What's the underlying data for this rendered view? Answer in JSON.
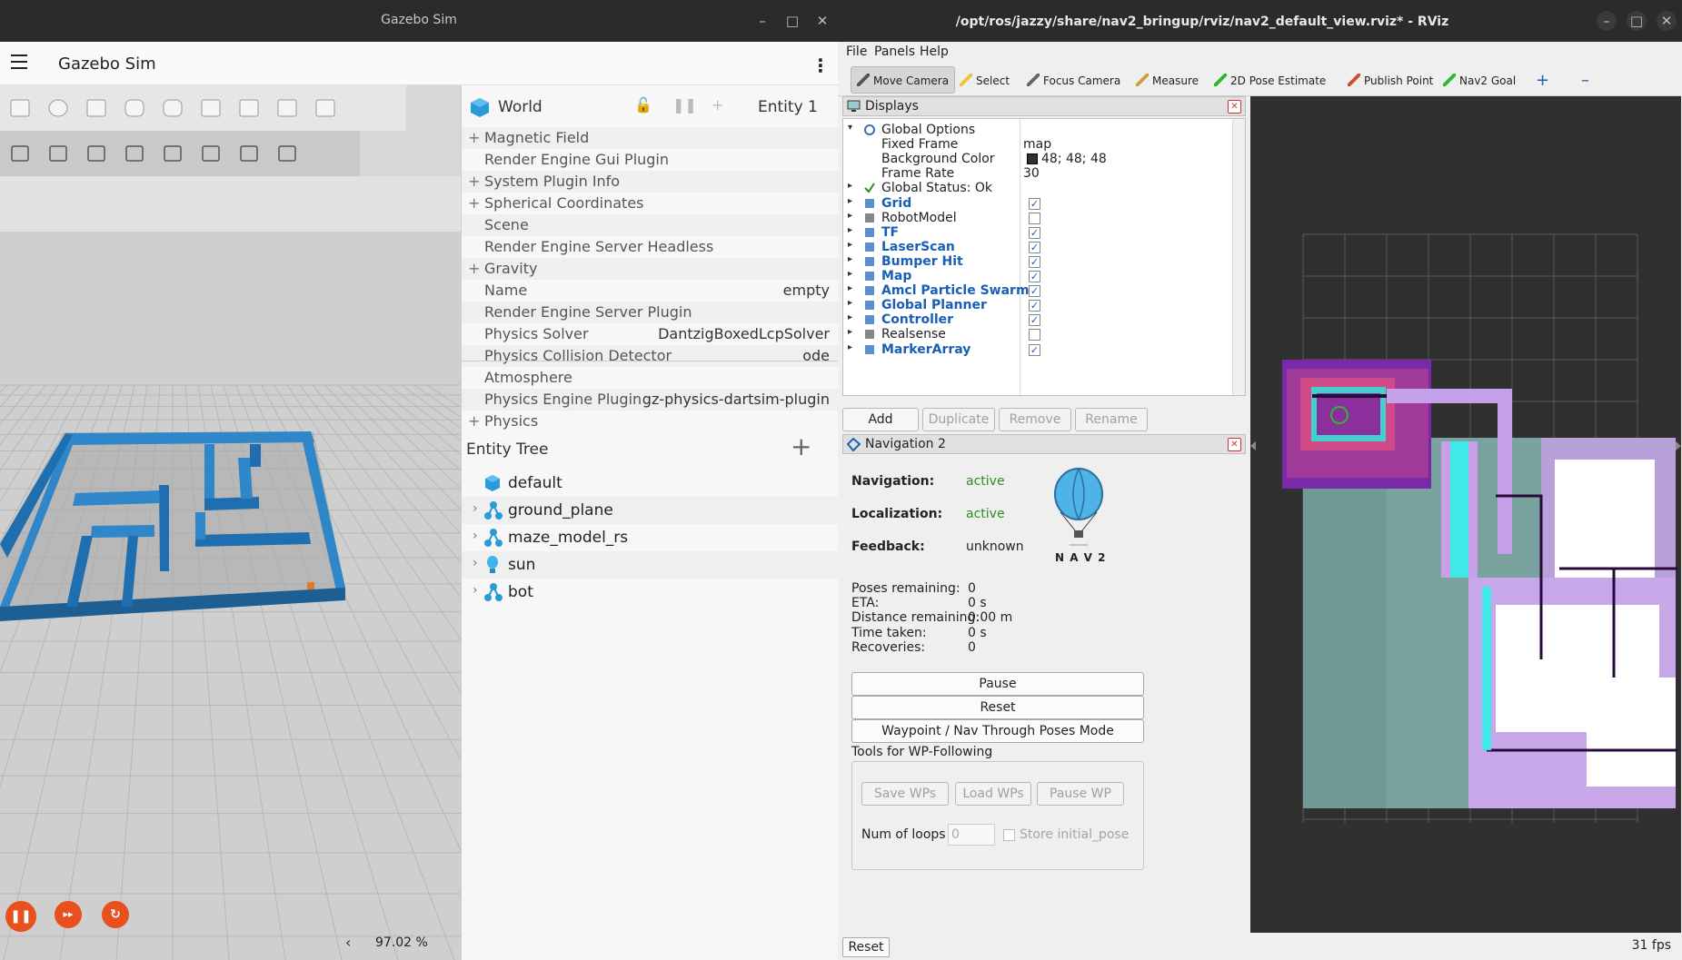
{
  "gazebo": {
    "window_title": "Gazebo Sim",
    "app_title": "Gazebo Sim",
    "zoom": "97.02 %",
    "world": {
      "title": "World",
      "entity_label": "Entity 1",
      "properties": [
        {
          "expand": "+",
          "key": "Magnetic Field",
          "value": ""
        },
        {
          "expand": "",
          "key": "Render Engine Gui Plugin",
          "value": ""
        },
        {
          "expand": "+",
          "key": "System Plugin Info",
          "value": ""
        },
        {
          "expand": "+",
          "key": "Spherical Coordinates",
          "value": ""
        },
        {
          "expand": "",
          "key": "Scene",
          "value": ""
        },
        {
          "expand": "",
          "key": "Render Engine Server Headless",
          "value": ""
        },
        {
          "expand": "+",
          "key": "Gravity",
          "value": ""
        },
        {
          "expand": "",
          "key": "Name",
          "value": "empty"
        },
        {
          "expand": "",
          "key": "Render Engine Server Plugin",
          "value": ""
        },
        {
          "expand": "",
          "key": "Physics Solver",
          "value": "DantzigBoxedLcpSolver"
        },
        {
          "expand": "",
          "key": "Physics Collision Detector",
          "value": "ode"
        },
        {
          "expand": "",
          "key": "Atmosphere",
          "value": ""
        },
        {
          "expand": "",
          "key": "Physics Engine Plugin",
          "value": "gz-physics-dartsim-plugin"
        },
        {
          "expand": "+",
          "key": "Physics",
          "value": ""
        }
      ]
    },
    "entity_tree": {
      "title": "Entity Tree",
      "add": "+",
      "items": [
        {
          "label": "default",
          "chevron": "",
          "icon": "world-cube-icon"
        },
        {
          "label": "ground_plane",
          "chevron": "›",
          "icon": "model-icon"
        },
        {
          "label": "maze_model_rs",
          "chevron": "›",
          "icon": "model-icon"
        },
        {
          "label": "sun",
          "chevron": "›",
          "icon": "light-bulb-icon"
        },
        {
          "label": "bot",
          "chevron": "›",
          "icon": "model-icon"
        }
      ]
    },
    "toolbar_icons": [
      "box-icon",
      "sphere-icon",
      "cone-icon",
      "cylinder-icon",
      "capsule-icon",
      "ellipsoid-icon",
      "sun-light-icon",
      "directional-light-icon",
      "spot-light-icon"
    ],
    "toolbar2_icons": [
      "select-icon",
      "translate-icon",
      "rotate-icon",
      "scale-icon",
      "grid-icon",
      "camera-icon",
      "copy-icon",
      "paste-icon"
    ],
    "colors": {
      "play": "#e8501e",
      "maze": "#1f6fb0"
    }
  },
  "rviz": {
    "window_title": "/opt/ros/jazzy/share/nav2_bringup/rviz/nav2_default_view.rviz* - RViz",
    "menu": [
      "File",
      "Panels",
      "Help"
    ],
    "tools": [
      {
        "label": "Move Camera",
        "icon": "move-camera-icon"
      },
      {
        "label": "Select",
        "icon": "select-icon"
      },
      {
        "label": "Focus Camera",
        "icon": "focus-camera-icon"
      },
      {
        "label": "Measure",
        "icon": "measure-icon"
      },
      {
        "label": "2D Pose Estimate",
        "icon": "pose-estimate-icon"
      },
      {
        "label": "Publish Point",
        "icon": "publish-point-icon"
      },
      {
        "label": "Nav2 Goal",
        "icon": "nav2-goal-icon"
      }
    ],
    "displays": {
      "title": "Displays",
      "global_options": "Global Options",
      "options": [
        {
          "key": "Fixed Frame",
          "value": "map"
        },
        {
          "key": "Background Color",
          "value": "48; 48; 48"
        },
        {
          "key": "Frame Rate",
          "value": "30"
        }
      ],
      "global_status": "Global Status: Ok",
      "items": [
        {
          "label": "Grid",
          "checked": true,
          "highlight": true
        },
        {
          "label": "RobotModel",
          "checked": false,
          "highlight": false
        },
        {
          "label": "TF",
          "checked": true,
          "highlight": true
        },
        {
          "label": "LaserScan",
          "checked": true,
          "highlight": true
        },
        {
          "label": "Bumper Hit",
          "checked": true,
          "highlight": true
        },
        {
          "label": "Map",
          "checked": true,
          "highlight": true
        },
        {
          "label": "Amcl Particle Swarm",
          "checked": true,
          "highlight": true
        },
        {
          "label": "Global Planner",
          "checked": true,
          "highlight": true
        },
        {
          "label": "Controller",
          "checked": true,
          "highlight": true
        },
        {
          "label": "Realsense",
          "checked": false,
          "highlight": false
        },
        {
          "label": "MarkerArray",
          "checked": true,
          "highlight": true
        }
      ],
      "buttons": {
        "add": "Add",
        "duplicate": "Duplicate",
        "remove": "Remove",
        "rename": "Rename"
      }
    },
    "nav2": {
      "title": "Navigation 2",
      "navigation_label": "Navigation:",
      "navigation_value": "active",
      "localization_label": "Localization:",
      "localization_value": "active",
      "feedback_label": "Feedback:",
      "feedback_value": "unknown",
      "logo_text": "N A V 2",
      "stats": [
        {
          "key": "Poses remaining:",
          "value": "0"
        },
        {
          "key": "ETA:",
          "value": "0 s"
        },
        {
          "key": "Distance remaining:",
          "value": "0.00 m"
        },
        {
          "key": "Time taken:",
          "value": "0 s"
        },
        {
          "key": "Recoveries:",
          "value": "0"
        }
      ],
      "pause": "Pause",
      "reset": "Reset",
      "waypoint_mode": "Waypoint / Nav Through Poses Mode",
      "wp_tools_label": "Tools for WP-Following",
      "save_wps": "Save WPs",
      "load_wps": "Load WPs",
      "pause_wp": "Pause WP",
      "num_loops_label": "Num of loops",
      "num_loops_value": "0",
      "store_initial_pose": "Store initial_pose"
    },
    "reset": "Reset",
    "fps": "31 fps"
  }
}
